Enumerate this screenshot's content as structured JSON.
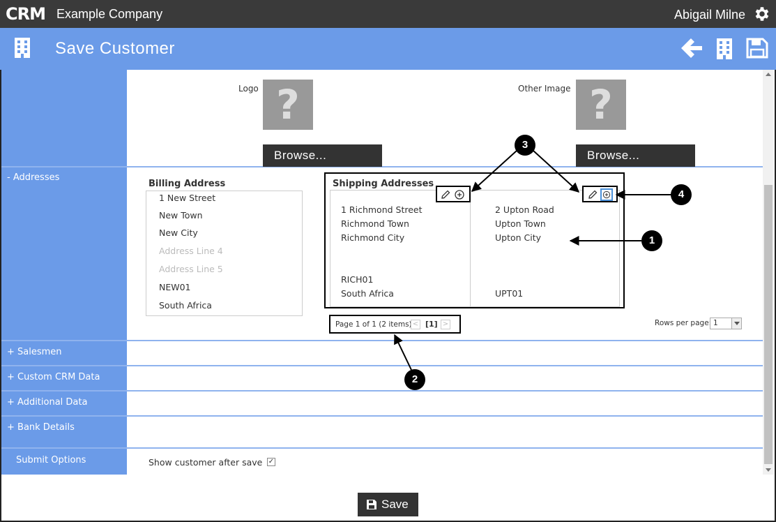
{
  "topbar": {
    "logo_text": "CRM",
    "company": "Example Company",
    "user": "Abigail Milne"
  },
  "header": {
    "title": "Save Customer",
    "icons": [
      "building-icon",
      "back-arrow-icon",
      "building-icon",
      "save-icon"
    ]
  },
  "images": {
    "logo_label": "Logo",
    "other_label": "Other Image",
    "placeholder_glyph": "?",
    "browse_label": "Browse..."
  },
  "sections": {
    "addresses": "- Addresses",
    "salesmen": "+ Salesmen",
    "custom_crm": "+ Custom CRM Data",
    "additional": "+ Additional Data",
    "bank": "+ Bank Details",
    "submit": "Submit Options"
  },
  "billing": {
    "title": "Billing Address",
    "lines": [
      "1 New Street",
      "New Town",
      "New City"
    ],
    "placeholder_line4": "Address Line 4",
    "placeholder_line5": "Address Line 5",
    "code": "NEW01",
    "country": "South Africa"
  },
  "shipping": {
    "title": "Shipping Addresses",
    "addresses": [
      {
        "lines": [
          "1 Richmond Street",
          "Richmond Town",
          "Richmond City"
        ],
        "code": "RICH01",
        "country": "South Africa"
      },
      {
        "lines": [
          "2 Upton Road",
          "Upton Town",
          "Upton City"
        ],
        "code": "UPT01",
        "country": ""
      }
    ]
  },
  "pager": {
    "summary": "Page 1 of 1 (2 items)",
    "prev": "<",
    "current": "[1]",
    "next": ">",
    "rows_label": "Rows per page:",
    "rows_value": "1"
  },
  "submit": {
    "show_after_save": "Show customer after save",
    "checked": true,
    "check_glyph": "✓"
  },
  "save_button": "Save",
  "callouts": [
    "1",
    "2",
    "3",
    "4"
  ],
  "colors": {
    "topbar": "#3a3a3a",
    "accent_blue": "#6b9be8",
    "button_dark": "#333333"
  }
}
